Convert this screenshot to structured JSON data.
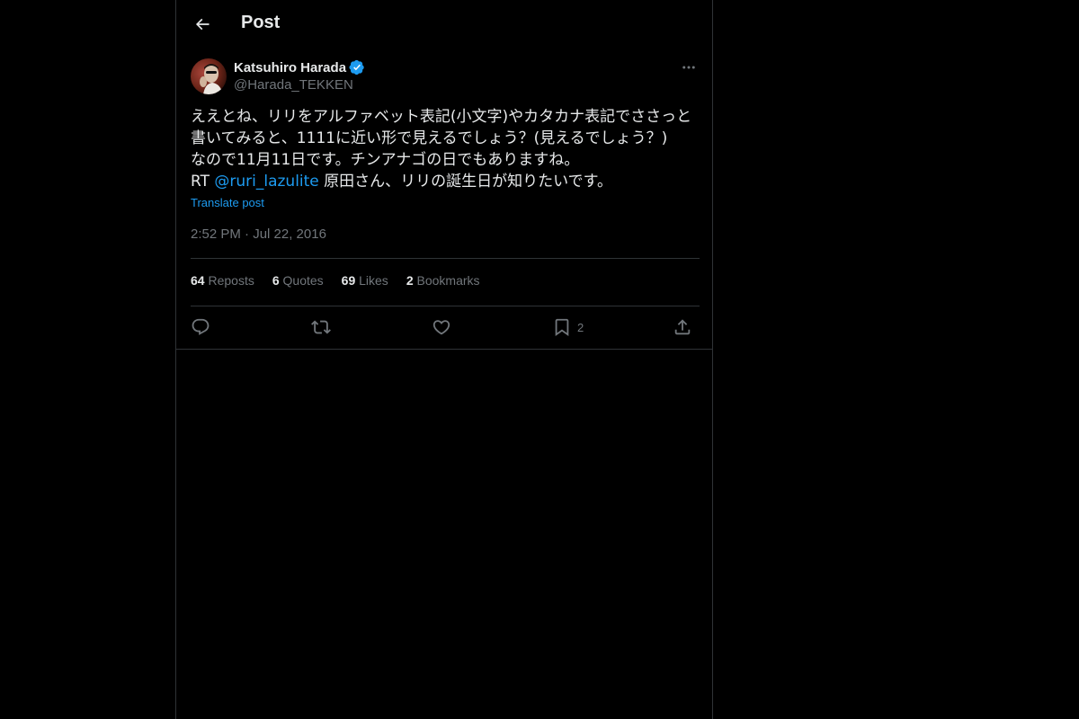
{
  "header": {
    "title": "Post",
    "back_icon": "arrow-left-icon"
  },
  "post": {
    "author": {
      "name": "Katsuhiro Harada",
      "handle": "@Harada_TEKKEN",
      "verified": true
    },
    "text_lines": [
      "ええとね、リリをアルファベット表記(小文字)やカタカナ表記でささっと",
      "書いてみると、1111に近い形で見えるでしょう？(見えるでしょう？)",
      "なので11月11日です。チンアナゴの日でもありますね。"
    ],
    "rt_prefix": "RT ",
    "mention": "@ruri_lazulite",
    "rt_text": " 原田さん、リリの誕生日が知りたいです。",
    "translate_label": "Translate post",
    "timestamp": "2:52 PM · Jul 22, 2016"
  },
  "stats": {
    "reposts": {
      "count": "64",
      "label": "Reposts"
    },
    "quotes": {
      "count": "6",
      "label": "Quotes"
    },
    "likes": {
      "count": "69",
      "label": "Likes"
    },
    "bookmarks": {
      "count": "2",
      "label": "Bookmarks"
    }
  },
  "actions": {
    "reply": {
      "icon": "reply-icon"
    },
    "repost": {
      "icon": "repost-icon"
    },
    "like": {
      "icon": "heart-icon"
    },
    "bookmark": {
      "icon": "bookmark-icon",
      "count": "2"
    },
    "share": {
      "icon": "share-icon"
    }
  },
  "colors": {
    "background": "#000000",
    "text": "#e7e9ea",
    "muted": "#71767b",
    "accent": "#1d9bf0",
    "border": "#2f3336"
  }
}
